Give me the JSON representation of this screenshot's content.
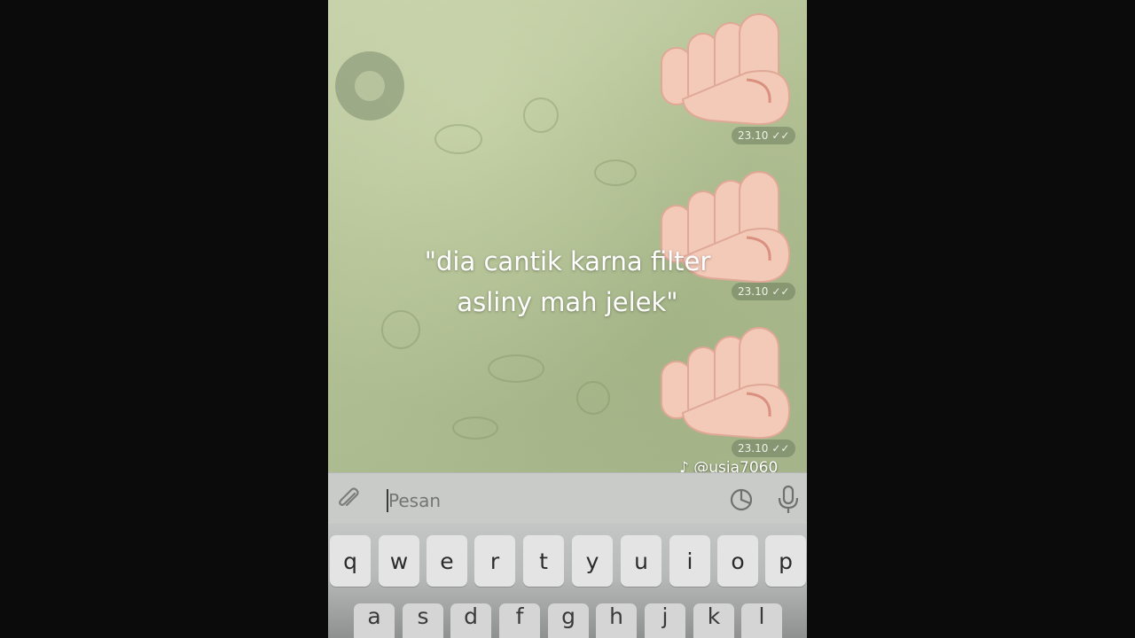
{
  "chat": {
    "messages": [
      {
        "sticker": "pointing-fist-sticker",
        "time": "23.10",
        "status": "read-double-check"
      },
      {
        "sticker": "pointing-fist-sticker",
        "time": "23.10",
        "status": "read-double-check"
      },
      {
        "sticker": "pointing-fist-sticker",
        "time": "23.10",
        "status": "read-double-check"
      }
    ]
  },
  "overlay": {
    "line1": "\"dia cantik karna filter",
    "line2": "asliny mah jelek\""
  },
  "watermark": "@usia7060",
  "composer": {
    "placeholder": "Pesan",
    "attach_icon": "paperclip-icon",
    "sticker_icon": "sticker-icon",
    "mic_icon": "microphone-icon"
  },
  "keyboard": {
    "row1": [
      "q",
      "w",
      "e",
      "r",
      "t",
      "y",
      "u",
      "i",
      "o",
      "p"
    ],
    "row2": [
      "a",
      "s",
      "d",
      "f",
      "g",
      "h",
      "j",
      "k",
      "l"
    ]
  },
  "colors": {
    "background": "#0b0b0b",
    "chat_bg": "#b3c195",
    "skin": "#f3c9b8"
  }
}
